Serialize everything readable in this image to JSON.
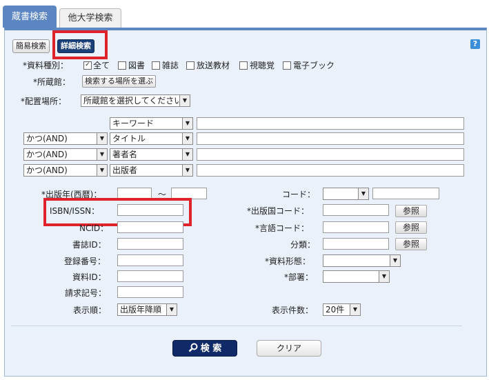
{
  "tabs": {
    "active": "蔵書検索",
    "other": "他大学検索"
  },
  "modes": {
    "simple": "簡易検索",
    "detailed": "詳細検索"
  },
  "help": "?",
  "material_type": {
    "label": "*資料種別：",
    "options": [
      "全て",
      "図書",
      "雑誌",
      "放送教材",
      "視聴覚",
      "電子ブック"
    ],
    "checked": "全て"
  },
  "holding": {
    "label": "*所蔵館：",
    "button": "検索する場所を選ぶ"
  },
  "location": {
    "label": "*配置場所：",
    "value": "所蔵館を選択してください"
  },
  "keyword_rows": [
    {
      "operator": "",
      "field": "キーワード",
      "value": ""
    },
    {
      "operator": "かつ(AND)",
      "field": "タイトル",
      "value": ""
    },
    {
      "operator": "かつ(AND)",
      "field": "著者名",
      "value": ""
    },
    {
      "operator": "かつ(AND)",
      "field": "出版者",
      "value": ""
    }
  ],
  "left_fields": {
    "year": {
      "label": "*出版年(西暦)：",
      "sep": "〜"
    },
    "isbn": {
      "label": "ISBN/ISSN："
    },
    "ncid": {
      "label": "NCID："
    },
    "bibid": {
      "label": "書誌ID："
    },
    "regno": {
      "label": "登録番号："
    },
    "matid": {
      "label": "資料ID："
    },
    "callno": {
      "label": "請求記号："
    },
    "sort": {
      "label": "表示順：",
      "value": "出版年降順"
    }
  },
  "right_fields": {
    "code": {
      "label": "コード："
    },
    "country": {
      "label": "*出版国コード：",
      "button": "参照"
    },
    "language": {
      "label": "*言語コード：",
      "button": "参照"
    },
    "classification": {
      "label": "分類：",
      "button": "参照"
    },
    "form": {
      "label": "*資料形態："
    },
    "dept": {
      "label": "*部署："
    },
    "count": {
      "label": "表示件数：",
      "value": "20件"
    }
  },
  "actions": {
    "search": "検 索",
    "clear": "クリア"
  },
  "colors": {
    "accent": "#5b86c2",
    "highlight": "#e0232b",
    "panel": "#eaf1fa"
  }
}
